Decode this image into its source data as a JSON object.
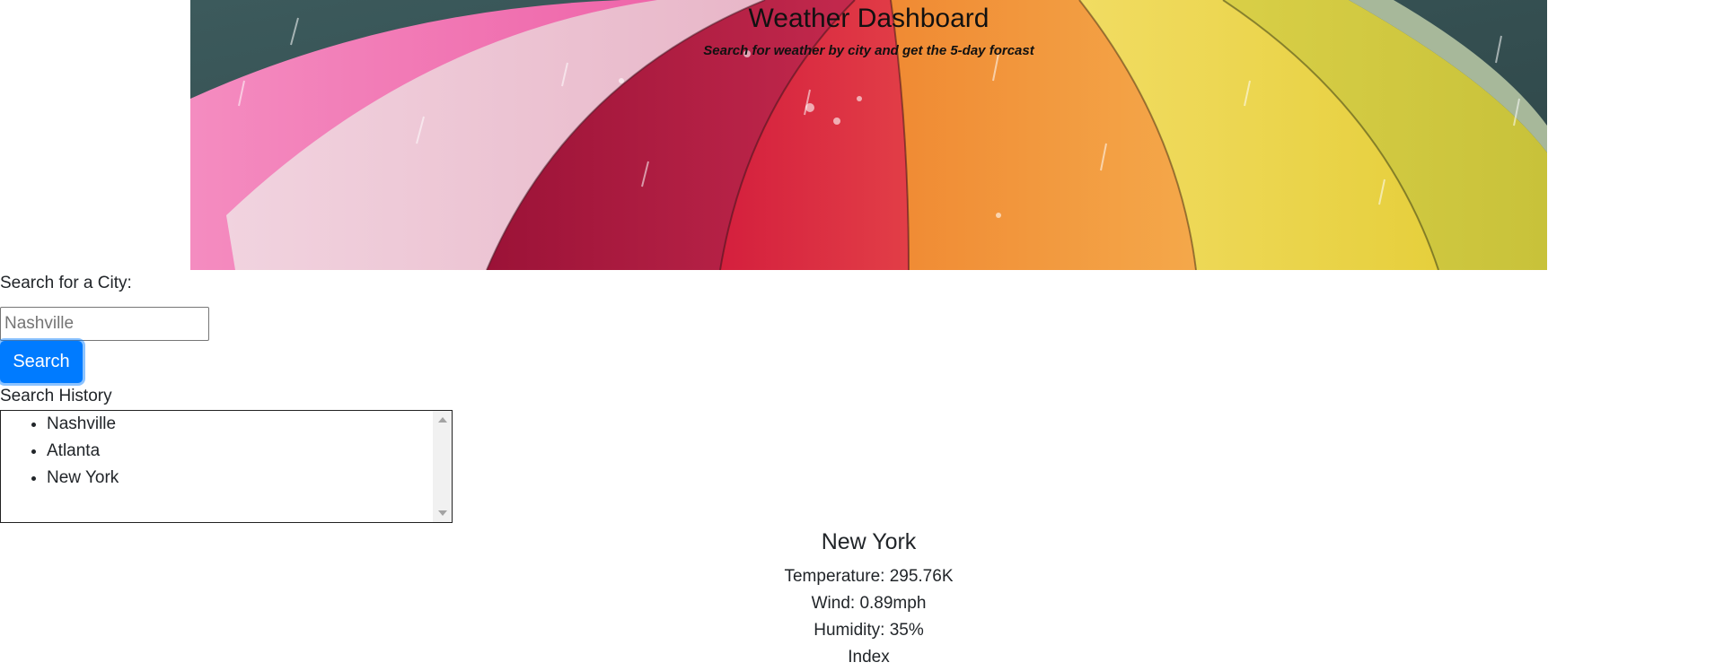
{
  "header": {
    "title": "Weather Dashboard",
    "subtitle": "Search for weather by city and get the 5-day forcast"
  },
  "search": {
    "label": "Search for a City:",
    "placeholder": "Nashville",
    "value": "",
    "button_label": "Search"
  },
  "history": {
    "label": "Search History",
    "items": [
      "Nashville",
      "Atlanta",
      "New York"
    ]
  },
  "current": {
    "city": "New York",
    "temperature": "Temperature: 295.76K",
    "wind": "Wind: 0.89mph",
    "humidity": "Humidity: 35%",
    "uv": "Index"
  },
  "colors": {
    "primary_button": "#007bff",
    "text": "#212529"
  }
}
